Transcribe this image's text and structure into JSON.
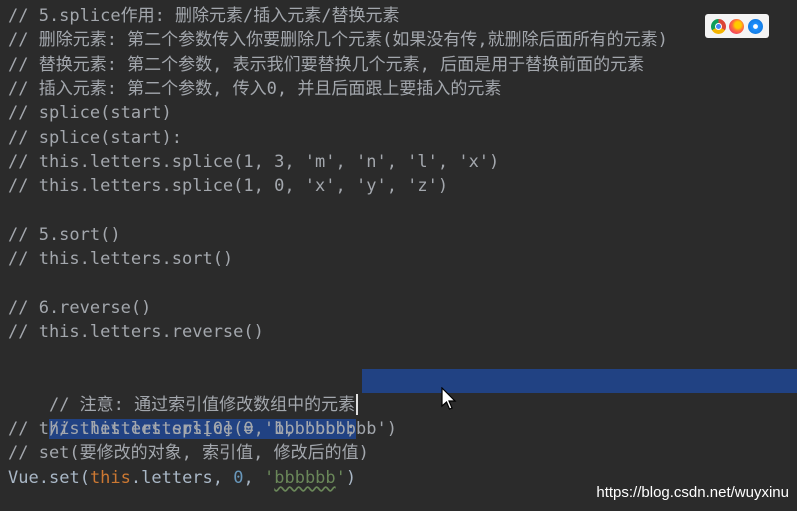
{
  "lines": [
    "// 5.splice作用: 删除元素/插入元素/替换元素",
    "// 删除元素: 第二个参数传入你要删除几个元素(如果没有传,就删除后面所有的元素)",
    "// 替换元素: 第二个参数, 表示我们要替换几个元素, 后面是用于替换前面的元素",
    "// 插入元素: 第二个参数, 传入0, 并且后面跟上要插入的元素",
    "// splice(start)",
    "// splice(start):",
    "// this.letters.splice(1, 3, 'm', 'n', 'l', 'x')",
    "// this.letters.splice(1, 0, 'x', 'y', 'z')",
    "",
    "// 5.sort()",
    "// this.letters.sort()",
    "",
    "// 6.reverse()",
    "// this.letters.reverse()",
    "",
    "// 注意: 通过索引值修改数组中的元素",
    "// this.letters[0] = 'bbbbbb';",
    "// this.letters.splice(0, 1, 'bbbbbb')",
    "// set(要修改的对象, 索引值, 修改后的值)"
  ],
  "last_line": {
    "obj": "Vue",
    "dot1": ".",
    "method": "set",
    "open": "(",
    "this_kw": "this",
    "prop": ".letters, ",
    "num": "0",
    "sep": ", ",
    "str_q1": "'",
    "str_val": "bbbbbb",
    "str_q2": "'",
    "close": ")"
  },
  "browser_icons": [
    "chrome-icon",
    "firefox-icon",
    "safari-icon"
  ],
  "watermark": "https://blog.csdn.net/wuyxinu",
  "colors": {
    "background": "#2b2b2b",
    "comment": "#a3a7ad",
    "selection": "#214283",
    "keyword": "#cc7832",
    "number": "#6897bb",
    "string": "#6a8759"
  }
}
